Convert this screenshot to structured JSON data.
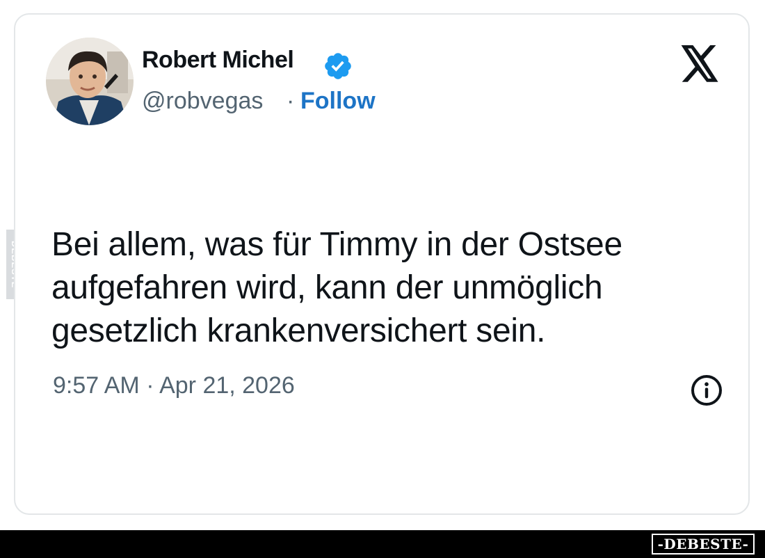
{
  "author": {
    "display_name": "Robert Michel",
    "handle": "@robvegas",
    "separator": "·",
    "follow_label": "Follow",
    "verified_color": "#1d9bf0"
  },
  "tweet": {
    "text_lines": [
      "Bei allem, was für Timmy in der Ostsee",
      "aufgefahren wird, kann der unmöglich",
      "gesetzlich krankenversichert sein."
    ],
    "timestamp": "9:57 AM · Apr 21, 2026"
  },
  "icons": {
    "logo": "x-logo-icon",
    "verified": "verified-badge-icon",
    "info": "info-icon"
  },
  "watermark": {
    "side_text": "DEBESTE",
    "stamp_text": "-DEBESTE-"
  },
  "colors": {
    "text_primary": "#0f1419",
    "text_secondary": "#536471",
    "link": "#1d74c6",
    "card_border": "#e3e6e8"
  }
}
